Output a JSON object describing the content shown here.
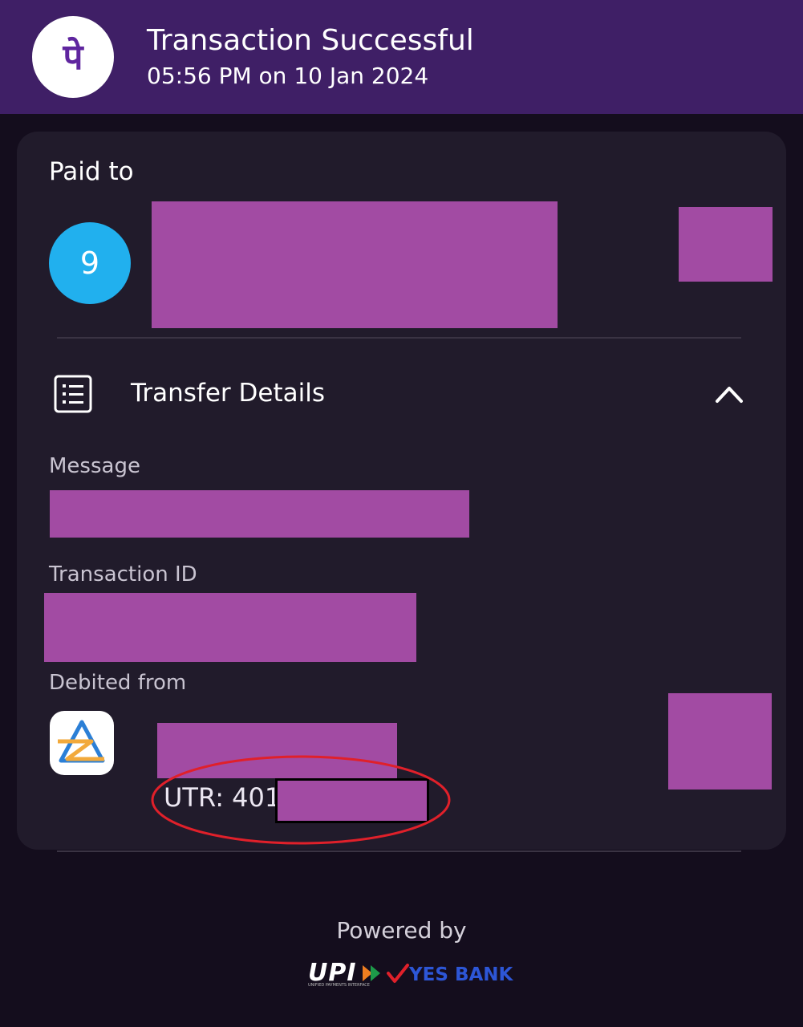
{
  "header": {
    "title": "Transaction Successful",
    "subtitle": "05:56 PM on 10 Jan 2024",
    "logo_glyph": "पे",
    "logo_icon": "phonepe-logo-icon"
  },
  "paid_to": {
    "label": "Paid to",
    "avatar_text": "9"
  },
  "transfer_details": {
    "label": "Transfer Details",
    "icon": "list-icon",
    "toggle_icon": "chevron-up-icon",
    "message_label": "Message",
    "transaction_id_label": "Transaction ID",
    "debited_from_label": "Debited from",
    "bank_icon": "bank-logo-icon",
    "utr_prefix": "UTR: 401"
  },
  "footer": {
    "powered_by": "Powered by",
    "upi_text": "UPI",
    "upi_subtext": "UNIFIED PAYMENTS INTERFACE",
    "bank_name": "YES BANK"
  },
  "colors": {
    "header_bg": "#3f1f66",
    "card_bg": "#211b2b",
    "page_bg": "#140d1d",
    "redaction": "#a24ba3",
    "avatar": "#21b0ee",
    "annotation": "#e0202a"
  }
}
